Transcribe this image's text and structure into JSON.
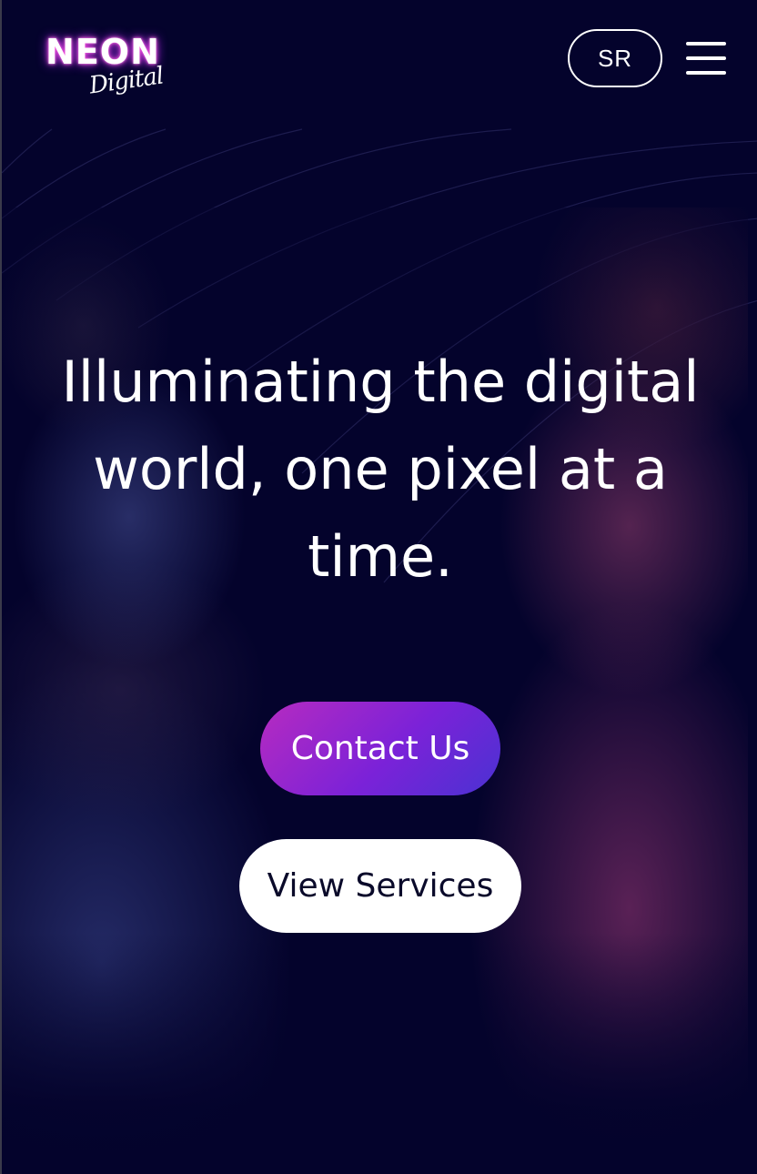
{
  "header": {
    "logo_word": "NEON",
    "logo_script": "Digital",
    "language_label": "SR"
  },
  "hero": {
    "headline": "Illuminating the digital world, one pixel at a time.",
    "primary_cta": "Contact Us",
    "secondary_cta": "View Services"
  },
  "colors": {
    "background": "#04032c",
    "cta_gradient_start": "#b72bc0",
    "cta_gradient_end": "#4a32d2",
    "text": "#ffffff"
  }
}
